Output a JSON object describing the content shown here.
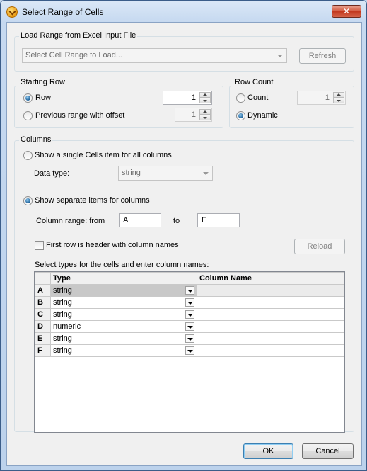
{
  "window": {
    "title": "Select Range of Cells",
    "close_label": "✕"
  },
  "load_range": {
    "group_label": "Load Range from Excel Input File",
    "cell_range_placeholder": "Select Cell Range to Load...",
    "refresh_label": "Refresh"
  },
  "starting_row": {
    "group_label": "Starting Row",
    "row_label": "Row",
    "row_value": "1",
    "previous_label": "Previous range with offset",
    "offset_value": "1"
  },
  "row_count": {
    "group_label": "Row Count",
    "count_label": "Count",
    "count_value": "1",
    "dynamic_label": "Dynamic"
  },
  "columns": {
    "group_label": "Columns",
    "single_label": "Show a single Cells item for all columns",
    "data_type_label": "Data type:",
    "data_type_value": "string",
    "separate_label": "Show separate items for columns",
    "range_label": "Column range: from",
    "range_from": "A",
    "range_to_label": "to",
    "range_to": "F",
    "first_row_label": "First row is header with column names",
    "reload_label": "Reload",
    "table_instruction": "Select types for the cells and enter column names:",
    "table_headers": [
      "",
      "Type",
      "Column Name"
    ],
    "rows": [
      {
        "col": "A",
        "type": "string",
        "name": ""
      },
      {
        "col": "B",
        "type": "string",
        "name": ""
      },
      {
        "col": "C",
        "type": "string",
        "name": ""
      },
      {
        "col": "D",
        "type": "numeric",
        "name": ""
      },
      {
        "col": "E",
        "type": "string",
        "name": ""
      },
      {
        "col": "F",
        "type": "string",
        "name": ""
      }
    ]
  },
  "footer": {
    "ok_label": "OK",
    "cancel_label": "Cancel"
  }
}
